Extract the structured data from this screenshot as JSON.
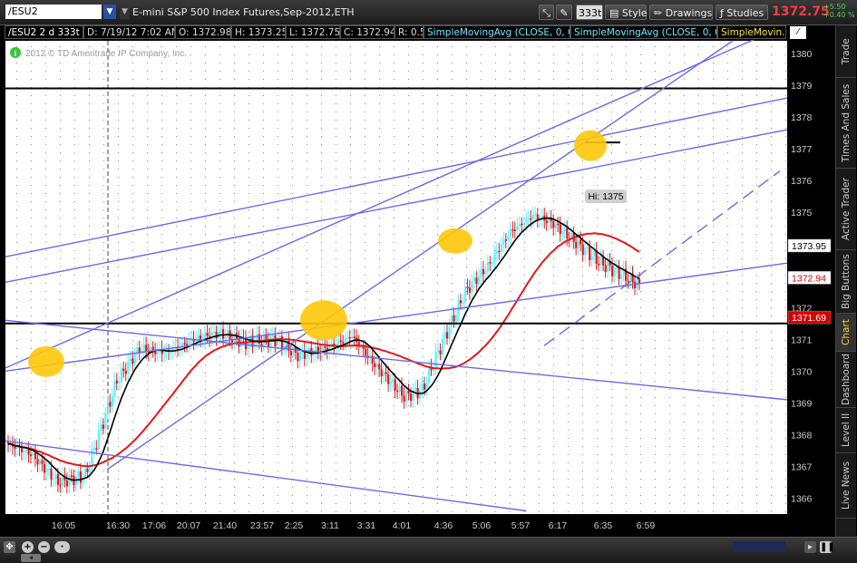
{
  "header": {
    "symbol": "/ESU2",
    "description": "E-mini S&P 500 Index Futures,Sep-2012,ETH",
    "aggregation": "333t",
    "style_label": "Style",
    "drawings_label": "Drawings",
    "studies_label": "Studies",
    "last_price": "1372.75",
    "net_change": "+5.50",
    "percent_change": "+0.40 %"
  },
  "infobar": {
    "symbol_period": "/ESU2 2 d 333t",
    "date": "D: 7/19/12 7:02 AM",
    "open": "O: 1372.98",
    "high": "H: 1373.25",
    "low": "L: 1372.75",
    "close": "C: 1372.94",
    "range": "R: 0.5",
    "study1": "SimpleMovingAvg (CLOSE, 0, 0)",
    "study2": "SimpleMovingAvg (CLOSE, 0, 0)",
    "study3": "SimpleMovin..."
  },
  "watermark": "2012 © TD Ameritrade IP Company, Inc.",
  "chart_data": {
    "type": "candlestick",
    "price_axis": {
      "ticks": [
        1366,
        1367,
        1368,
        1369,
        1370,
        1371,
        1372,
        1373,
        1374,
        1375,
        1376,
        1377,
        1378,
        1379,
        1380
      ],
      "range": [
        1365.5,
        1380.4
      ]
    },
    "time_axis": {
      "ticks": [
        "16:05",
        "16:30",
        "17:06",
        "20:07",
        "21:40",
        "23:57",
        "2:25",
        "3:11",
        "3:31",
        "4:01",
        "4:36",
        "5:06",
        "5:57",
        "6:17",
        "6:35",
        "6:59"
      ]
    },
    "price_bubbles": [
      {
        "value": 1373.95,
        "label": "1373.95",
        "color": "#ffffff",
        "text_color": "#000000"
      },
      {
        "value": 1372.94,
        "label": "1372.94",
        "color": "#ffffff",
        "text_color": "#d40000"
      },
      {
        "value": 1371.69,
        "label": "1371.69",
        "color": "#d40000",
        "text_color": "#ffffff"
      }
    ],
    "high_label": "Hi: 1375",
    "high_value": 1375,
    "horizontal_lines": [
      1378.9,
      1371.5
    ],
    "colors": {
      "up": "#5cf0ff",
      "down": "#e01818",
      "fast_ma": "#000000",
      "slow_ma": "#e01818",
      "trendline": "#6a6ae6",
      "highlight": "#ffc60a",
      "hline": "#000000",
      "background": "#ffffff"
    }
  },
  "sidebar": {
    "tabs": [
      "Trade",
      "Times And Sales",
      "Active Trader",
      "Big Buttons",
      "Chart",
      "Dashboard",
      "Level II",
      "Live News"
    ],
    "active": "Chart"
  }
}
